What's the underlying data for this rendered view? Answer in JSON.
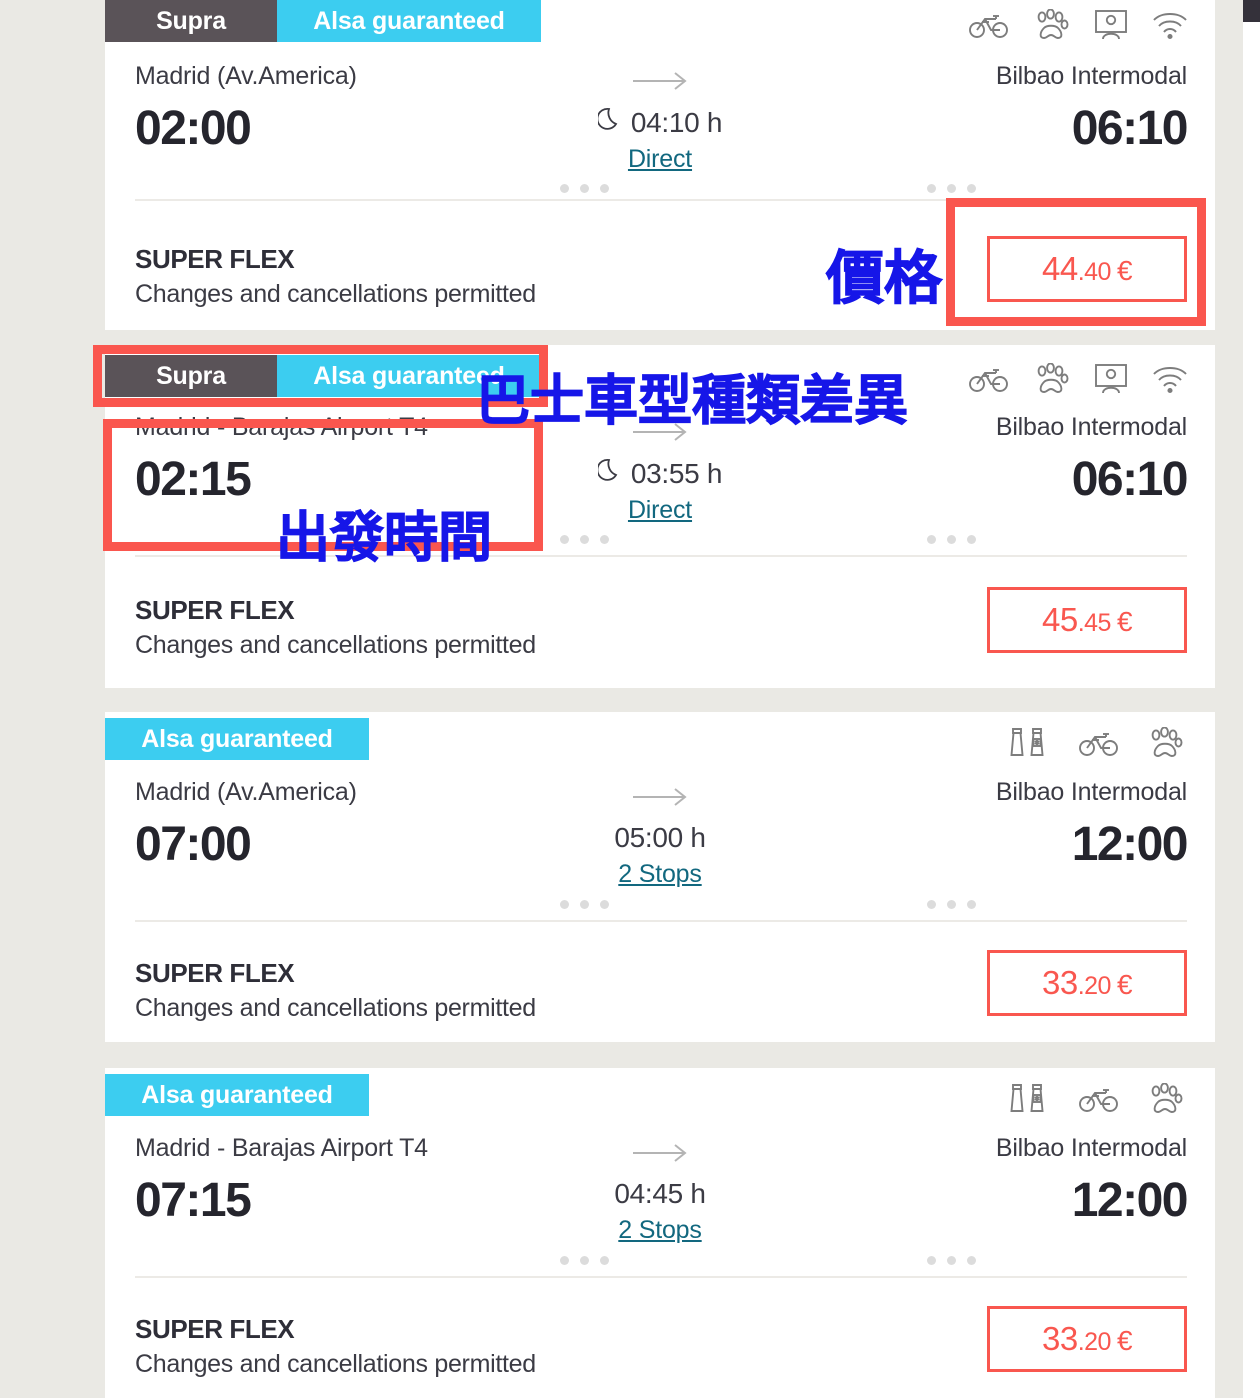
{
  "theme": {
    "page_bg": "#eae9e4",
    "card_bg": "#ffffff",
    "supra_badge_bg": "#5a5358",
    "alsa_badge_bg": "#3ccdf0",
    "price_color": "#f9574f",
    "link_color": "#12687f",
    "annotation_box_color": "#fa564e",
    "annotation_text_color": "#1616e8"
  },
  "results": [
    {
      "badges": [
        {
          "label": "Supra",
          "style": "supra"
        },
        {
          "label": "Alsa guaranteed",
          "style": "alsa"
        }
      ],
      "amenities": [
        "bicycle-icon",
        "paw-icon",
        "screen-icon",
        "wifi-icon"
      ],
      "origin": "Madrid (Av.America)",
      "departure": "02:00",
      "destination": "Bilbao Intermodal",
      "arrival": "06:10",
      "duration": "04:10 h",
      "night": true,
      "stops": "Direct",
      "fare_name": "SUPER FLEX",
      "fare_desc": "Changes and cancellations permitted",
      "price": {
        "major": "44",
        "minor": ".40",
        "currency": "€"
      }
    },
    {
      "badges": [
        {
          "label": "Supra",
          "style": "supra"
        },
        {
          "label": "Alsa guaranteed",
          "style": "alsa"
        }
      ],
      "amenities": [
        "bicycle-icon",
        "paw-icon",
        "screen-icon",
        "wifi-icon"
      ],
      "origin": "Madrid - Barajas Airport T4",
      "departure": "02:15",
      "destination": "Bilbao Intermodal",
      "arrival": "06:10",
      "duration": "03:55 h",
      "night": true,
      "stops": "Direct",
      "fare_name": "SUPER FLEX",
      "fare_desc": "Changes and cancellations permitted",
      "price": {
        "major": "45",
        "minor": ".45",
        "currency": "€"
      }
    },
    {
      "badges": [
        {
          "label": "Alsa guaranteed",
          "style": "alsa"
        }
      ],
      "amenities": [
        "luggage-icon",
        "bicycle-icon",
        "paw-icon"
      ],
      "origin": "Madrid (Av.America)",
      "departure": "07:00",
      "destination": "Bilbao Intermodal",
      "arrival": "12:00",
      "duration": "05:00 h",
      "night": false,
      "stops": "2 Stops",
      "fare_name": "SUPER FLEX",
      "fare_desc": "Changes and cancellations permitted",
      "price": {
        "major": "33",
        "minor": ".20",
        "currency": "€"
      }
    },
    {
      "badges": [
        {
          "label": "Alsa guaranteed",
          "style": "alsa"
        }
      ],
      "amenities": [
        "luggage-icon",
        "bicycle-icon",
        "paw-icon"
      ],
      "origin": "Madrid - Barajas Airport T4",
      "departure": "07:15",
      "destination": "Bilbao Intermodal",
      "arrival": "12:00",
      "duration": "04:45 h",
      "night": false,
      "stops": "2 Stops",
      "fare_name": "SUPER FLEX",
      "fare_desc": "Changes and cancellations permitted",
      "price": {
        "major": "33",
        "minor": ".20",
        "currency": "€"
      }
    }
  ],
  "annotations": [
    {
      "text": "價格",
      "note": "price"
    },
    {
      "text": "巴士車型種類差異",
      "note": "bus-type-difference"
    },
    {
      "text": "出發時間",
      "note": "departure-time"
    }
  ]
}
